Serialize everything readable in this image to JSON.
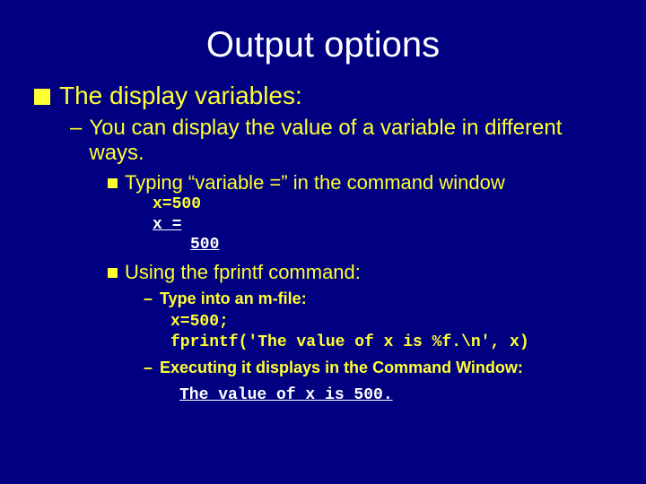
{
  "title": "Output options",
  "l1": {
    "text": "The display variables:"
  },
  "l2": {
    "text": "You can display the value of a variable in different ways."
  },
  "l3a": {
    "text": "Typing “variable =” in the command window"
  },
  "code1": {
    "line1": "x=500",
    "line2": "x =",
    "line3": "500"
  },
  "l3b": {
    "text": "Using the fprintf command:"
  },
  "l4a": {
    "text": "Type into an m-file:"
  },
  "code2": {
    "line1": "x=500;",
    "line2": "fprintf('The value of x is %f.\\n', x)"
  },
  "l4b": {
    "text": "Executing it displays in the Command Window:"
  },
  "code3": {
    "line1": "The value of x is 500."
  }
}
